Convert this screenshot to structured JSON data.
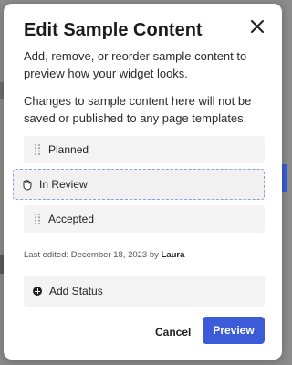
{
  "modal": {
    "title": "Edit Sample Content",
    "description_1": "Add, remove, or reorder sample content to preview how your widget looks.",
    "description_2": "Changes to sample content here will not be saved or published to any page templates."
  },
  "items": [
    {
      "label": "Planned"
    },
    {
      "label": "In Review",
      "state": "dragging"
    },
    {
      "label": "Accepted"
    }
  ],
  "meta": {
    "prefix": "Last edited: December 18, 2023 by",
    "author": "Laura"
  },
  "add_status_label": "Add Status",
  "footer": {
    "cancel_label": "Cancel",
    "preview_label": "Preview"
  },
  "colors": {
    "accent": "#3b5bd9",
    "row_bg": "#f3f3f3",
    "drag_outline": "#8a9ee0"
  },
  "icons": [
    "close-icon",
    "drag-handle-icon",
    "grab-hand-icon",
    "plus-circle-icon"
  ]
}
